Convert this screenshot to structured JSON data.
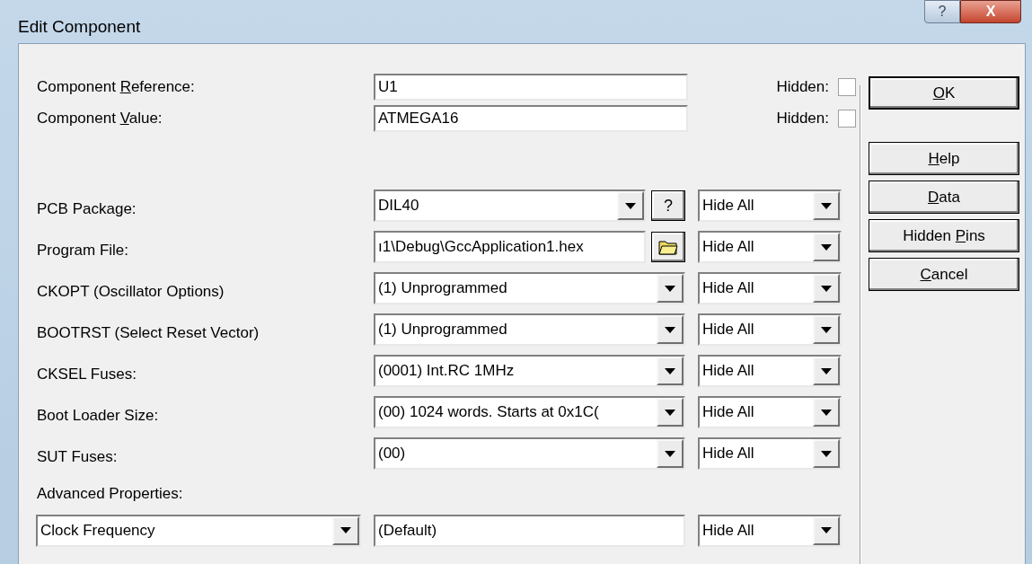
{
  "window": {
    "title": "Edit Component",
    "help_button": "?",
    "close_button": "X"
  },
  "identity": [
    {
      "label": {
        "pre": "Component ",
        "key": "R",
        "post": "eference:"
      },
      "value": "U1",
      "hidden_label": "Hidden:",
      "hidden": false
    },
    {
      "label": {
        "pre": "Component ",
        "key": "V",
        "post": "alue:"
      },
      "value": "ATMEGA16",
      "hidden_label": "Hidden:",
      "hidden": false
    }
  ],
  "properties": [
    {
      "kind": "combo_help",
      "label": "PCB Package:",
      "value": "DIL40",
      "side_button": "?",
      "visibility": "Hide All"
    },
    {
      "kind": "file",
      "label": "Program File:",
      "value": "ı1\\Debug\\GccApplication1.hex",
      "visibility": "Hide All"
    },
    {
      "kind": "combo",
      "label": "CKOPT (Oscillator Options)",
      "value": "(1) Unprogrammed",
      "visibility": "Hide All"
    },
    {
      "kind": "combo",
      "label": "BOOTRST (Select Reset Vector)",
      "value": "(1) Unprogrammed",
      "visibility": "Hide All"
    },
    {
      "kind": "combo",
      "label": "CKSEL Fuses:",
      "value": "(0001) Int.RC 1MHz",
      "visibility": "Hide All"
    },
    {
      "kind": "combo",
      "label": "Boot Loader Size:",
      "value": "(00) 1024 words. Starts at 0x1C(",
      "visibility": "Hide All"
    },
    {
      "kind": "combo",
      "label": "SUT Fuses:",
      "value": "(00)",
      "visibility": "Hide All"
    }
  ],
  "advanced": {
    "label": "Advanced Properties:",
    "property": "Clock Frequency",
    "value": "(Default)",
    "visibility": "Hide All"
  },
  "buttons": [
    {
      "key": "O",
      "post": "K",
      "default": true
    },
    {
      "key": "H",
      "post": "elp",
      "default": false
    },
    {
      "key": "D",
      "post": "ata",
      "default": false
    },
    {
      "pre": "Hidden ",
      "key": "P",
      "post": "ins",
      "default": false
    },
    {
      "key": "C",
      "post": "ancel",
      "default": false
    }
  ]
}
